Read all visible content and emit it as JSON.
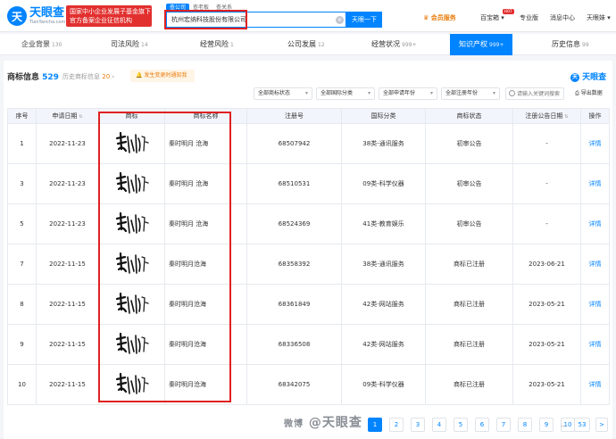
{
  "header": {
    "logo": {
      "mark": "天",
      "name": "天眼查",
      "domain": "TianYancha.com"
    },
    "promo": {
      "line1": "国家中小企业发展子基金旗下",
      "line2": "官方备案企业征信机构"
    },
    "search_tabs": [
      "查公司",
      "查老板",
      "查关系"
    ],
    "search": {
      "value": "杭州宏纳科技股份有限公司",
      "button": "天眼一下"
    },
    "nav": {
      "member": "会员服务",
      "baibao": "百宝箱",
      "hot": "HOT",
      "pro": "专业版",
      "msg": "消息中心",
      "user": "天眼妹"
    }
  },
  "tabs": [
    {
      "label": "企业背景",
      "count": "130"
    },
    {
      "label": "司法风险",
      "count": "14"
    },
    {
      "label": "经营风险",
      "count": "1"
    },
    {
      "label": "公司发展",
      "count": "12"
    },
    {
      "label": "经营状况",
      "count": "999+"
    },
    {
      "label": "知识产权",
      "count": "999+"
    },
    {
      "label": "历史信息",
      "count": "99"
    }
  ],
  "section": {
    "title": "商标信息",
    "count": "529",
    "history_label": "历史商标信息",
    "history_count": "20",
    "alert": "发生变更时通知我",
    "brand": "天眼查"
  },
  "filters": [
    "全部商标状态",
    "全部国际分类",
    "全部申请年份",
    "全部注册年份"
  ],
  "filter_placeholder": "请输入关键词搜索",
  "export_label": "导出数据",
  "table": {
    "headers": [
      "序号",
      "申请日期",
      "商标",
      "商标名称",
      "注册号",
      "国际分类",
      "商标状态",
      "注册公告日期",
      "操作"
    ],
    "rows": [
      {
        "no": "1",
        "date": "2022-11-23",
        "name": "秦时明月 沧海",
        "reg": "68507942",
        "cls": "38类-通讯服务",
        "status": "初审公告",
        "pub": "-",
        "op": "详情"
      },
      {
        "no": "3",
        "date": "2022-11-23",
        "name": "秦时明月 沧海",
        "reg": "68510531",
        "cls": "09类-科学仪器",
        "status": "初审公告",
        "pub": "-",
        "op": "详情"
      },
      {
        "no": "5",
        "date": "2022-11-23",
        "name": "秦时明月 沧海",
        "reg": "68524369",
        "cls": "41类-教育娱乐",
        "status": "初审公告",
        "pub": "-",
        "op": "详情"
      },
      {
        "no": "7",
        "date": "2022-11-15",
        "name": "秦时明月沧海",
        "reg": "68358392",
        "cls": "38类-通讯服务",
        "status": "商标已注册",
        "pub": "2023-06-21",
        "op": "详情"
      },
      {
        "no": "8",
        "date": "2022-11-15",
        "name": "秦时明月沧海",
        "reg": "68361849",
        "cls": "42类-网站服务",
        "status": "商标已注册",
        "pub": "2023-05-21",
        "op": "详情"
      },
      {
        "no": "9",
        "date": "2022-11-15",
        "name": "秦时明月沧海",
        "reg": "68336508",
        "cls": "42类-网站服务",
        "status": "商标已注册",
        "pub": "2023-05-21",
        "op": "详情"
      },
      {
        "no": "10",
        "date": "2022-11-15",
        "name": "秦时明月沧海",
        "reg": "68342075",
        "cls": "09类-科学仪器",
        "status": "商标已注册",
        "pub": "2023-05-21",
        "op": "详情"
      }
    ]
  },
  "pagination": {
    "pages": [
      "1",
      "2",
      "3",
      "4",
      "5",
      "6",
      "7",
      "8",
      "9",
      "10"
    ],
    "ellipsis": "...",
    "last": "53",
    "next": ">"
  },
  "watermark": {
    "prefix": "微博",
    "text": "@天眼查"
  },
  "colors": {
    "brand": "#0084ff",
    "highlight": "#e02020",
    "promo": "#e2302f",
    "member": "#e97c0b"
  }
}
